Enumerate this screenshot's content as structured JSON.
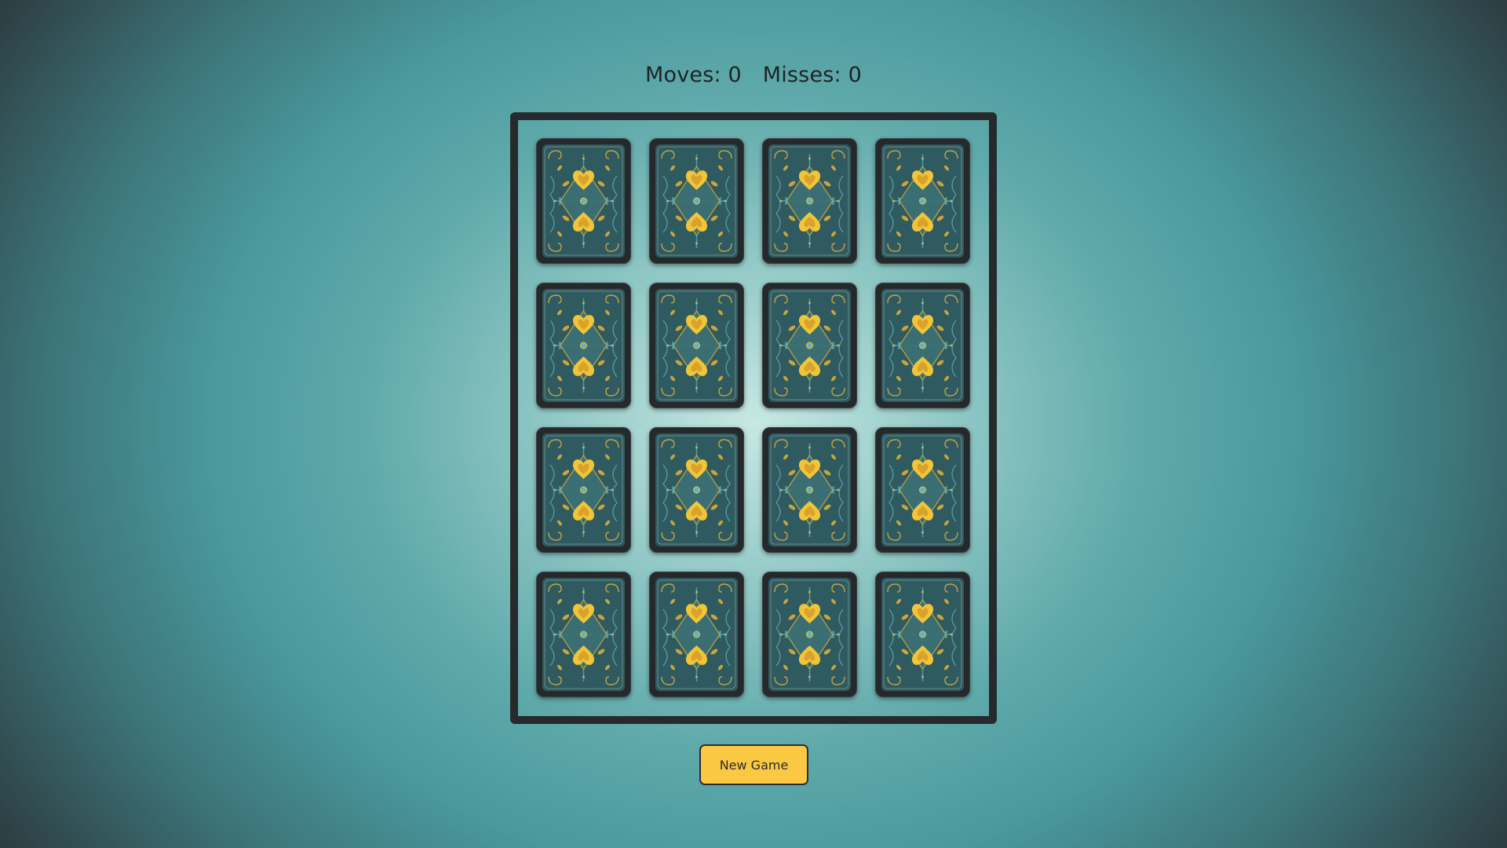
{
  "scoreboard": {
    "moves_label": "Moves: 0",
    "misses_label": "Misses: 0"
  },
  "board": {
    "rows": 4,
    "columns": 4,
    "card_state": "face-down",
    "card_back_icon": "ornate-card-back-icon"
  },
  "controls": {
    "new_game_label": "New Game"
  },
  "colors": {
    "accent": "#fbc843",
    "card_back_teal": "#3f6f74",
    "card_back_gold": "#e2b43a",
    "frame": "#262a2d"
  }
}
